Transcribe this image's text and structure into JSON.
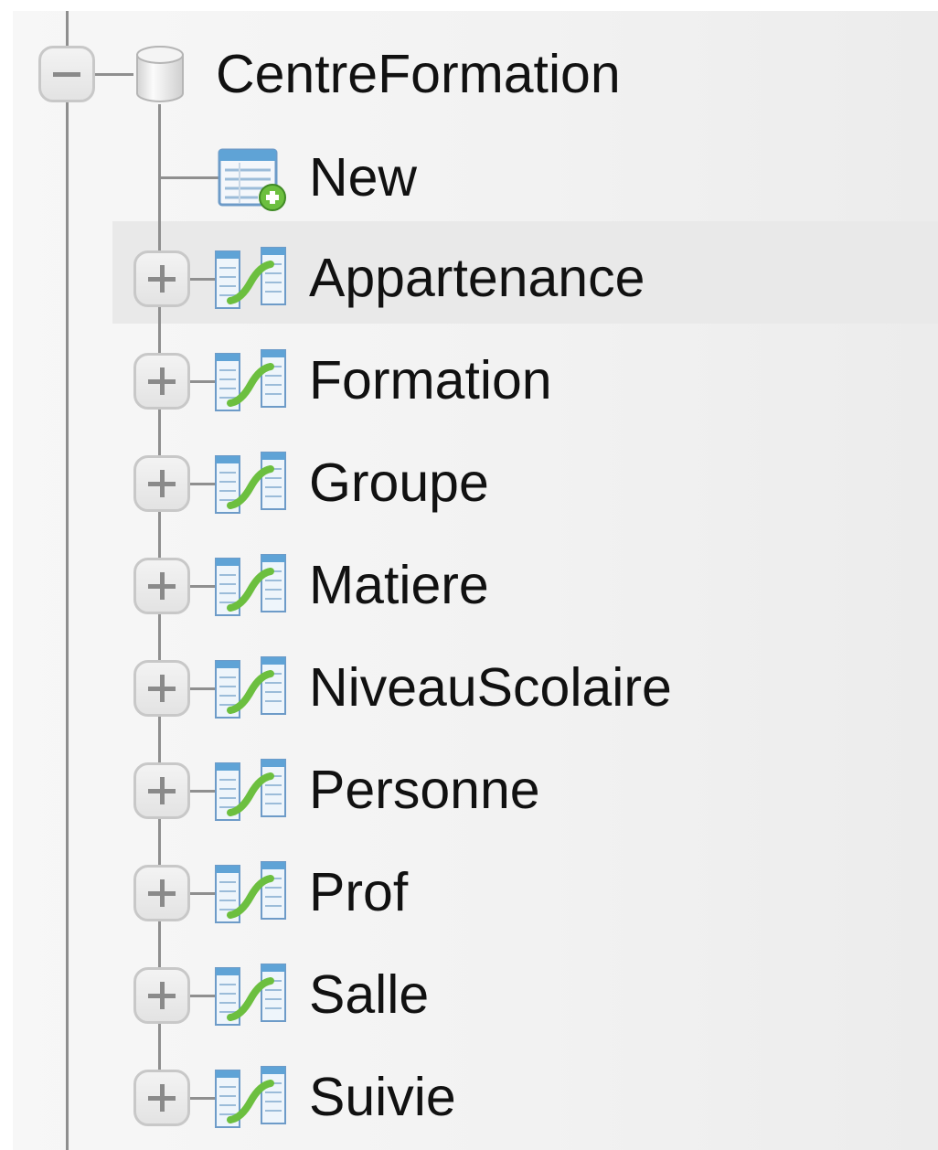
{
  "tree": {
    "root": {
      "label": "CentreFormation",
      "icon": "database-icon",
      "expanded": true
    },
    "new_item": {
      "label": "New",
      "icon": "new-table-icon"
    },
    "tables": [
      {
        "label": "Appartenance",
        "icon": "table-relation-icon",
        "highlighted": true
      },
      {
        "label": "Formation",
        "icon": "table-relation-icon"
      },
      {
        "label": "Groupe",
        "icon": "table-relation-icon"
      },
      {
        "label": "Matiere",
        "icon": "table-relation-icon"
      },
      {
        "label": "NiveauScolaire",
        "icon": "table-relation-icon"
      },
      {
        "label": "Personne",
        "icon": "table-relation-icon"
      },
      {
        "label": "Prof",
        "icon": "table-relation-icon"
      },
      {
        "label": "Salle",
        "icon": "table-relation-icon"
      },
      {
        "label": "Suivie",
        "icon": "table-relation-icon"
      }
    ]
  },
  "colors": {
    "panel_bg": "#f2f2f2",
    "highlight_row": "#e9e9e9",
    "tree_line": "#8f8f8f",
    "icon_green": "#6cbf3f",
    "icon_blue": "#5fa3d6"
  }
}
